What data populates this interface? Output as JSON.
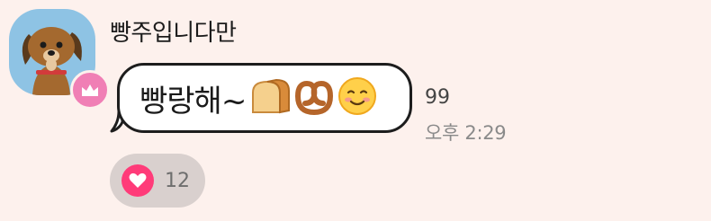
{
  "message": {
    "sender_name": "빵주입니다만",
    "text": "빵랑해~",
    "emojis": [
      "bread-icon",
      "pretzel-icon",
      "smiling-face-icon"
    ],
    "unread_count": "99",
    "time": "오후 2:29"
  },
  "reaction": {
    "icon": "heart-icon",
    "count": "12",
    "color": "#ff3b79"
  },
  "colors": {
    "background": "#fdf1ed",
    "avatar_bg": "#8ec3e4",
    "badge": "#f07fb5",
    "reaction_bg": "#d9d0ce"
  }
}
